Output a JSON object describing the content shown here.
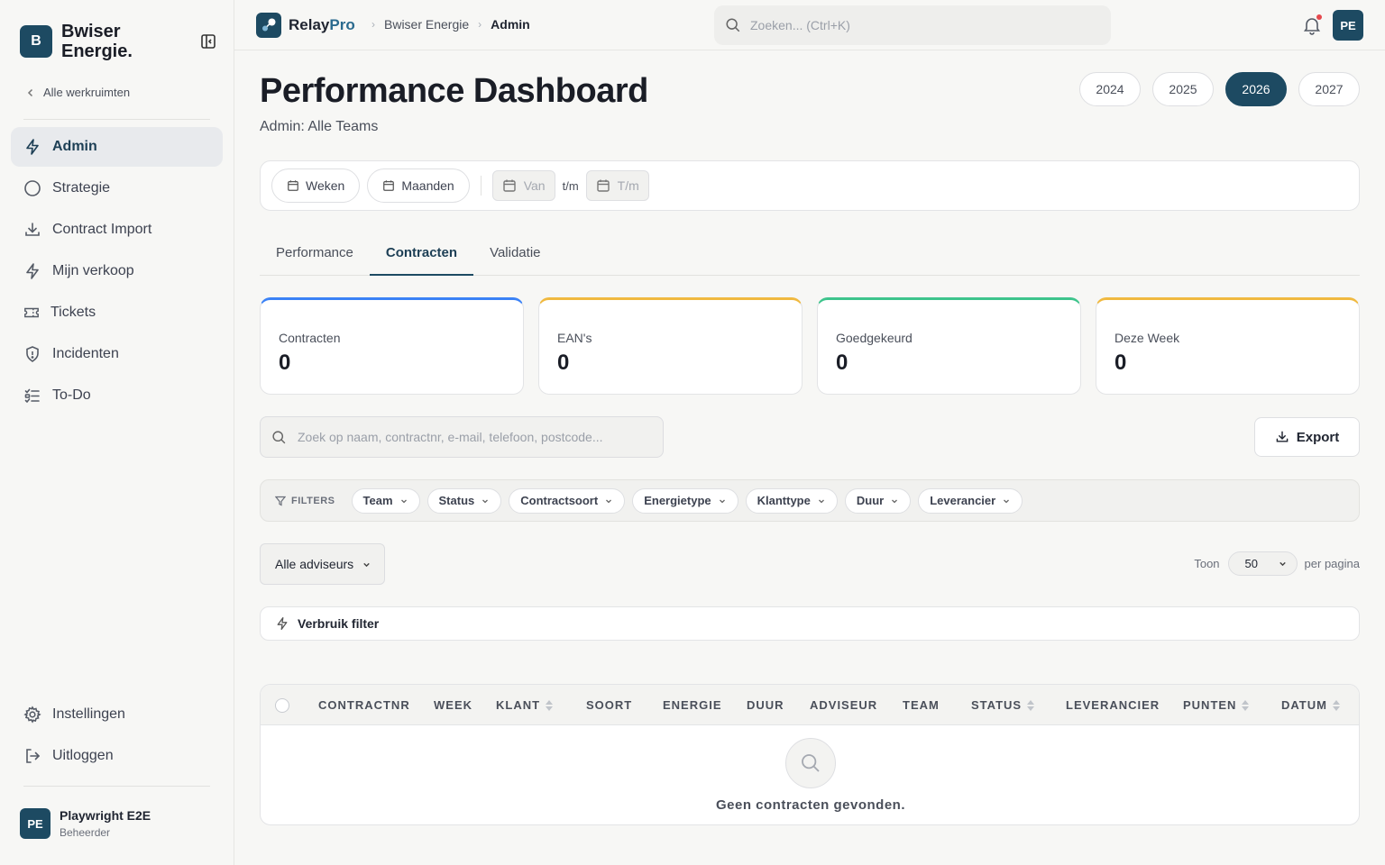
{
  "sidebar": {
    "brand_initial": "B",
    "brand_name": "Bwiser Energie.",
    "back_label": "Alle werkruimten",
    "items": [
      {
        "label": "Admin",
        "icon": "bolt-icon",
        "active": true
      },
      {
        "label": "Strategie",
        "icon": "circle-icon"
      },
      {
        "label": "Contract Import",
        "icon": "download-icon"
      },
      {
        "label": "Mijn verkoop",
        "icon": "bolt-icon"
      },
      {
        "label": "Tickets",
        "icon": "ticket-icon"
      },
      {
        "label": "Incidenten",
        "icon": "shield-alert-icon"
      },
      {
        "label": "To-Do",
        "icon": "checklist-icon"
      }
    ],
    "bottom_items": [
      {
        "label": "Instellingen",
        "icon": "gear-icon"
      },
      {
        "label": "Uitloggen",
        "icon": "logout-icon"
      }
    ],
    "user": {
      "initials": "PE",
      "name": "Playwright E2E",
      "role": "Beheerder"
    }
  },
  "topbar": {
    "logo_main": "Relay",
    "logo_accent": "Pro",
    "breadcrumb": [
      "Bwiser Energie",
      "Admin"
    ],
    "search_placeholder": "Zoeken... (Ctrl+K)",
    "avatar_initials": "PE"
  },
  "page": {
    "title": "Performance Dashboard",
    "subtitle": "Admin: Alle Teams",
    "years": [
      "2024",
      "2025",
      "2026",
      "2027"
    ],
    "active_year": "2026"
  },
  "range": {
    "weeks_label": "Weken",
    "months_label": "Maanden",
    "from_placeholder": "Van",
    "to_separator": "t/m",
    "to_placeholder": "T/m"
  },
  "tabs": [
    {
      "label": "Performance"
    },
    {
      "label": "Contracten",
      "active": true
    },
    {
      "label": "Validatie"
    }
  ],
  "stats": [
    {
      "label": "Contracten",
      "value": "0",
      "color": "#3b82f6"
    },
    {
      "label": "EAN's",
      "value": "0",
      "color": "#f0b940"
    },
    {
      "label": "Goedgekeurd",
      "value": "0",
      "color": "#3ec48c"
    },
    {
      "label": "Deze Week",
      "value": "0",
      "color": "#f0b940"
    }
  ],
  "search_placeholder": "Zoek op naam, contractnr, e-mail, telefoon, postcode...",
  "export_label": "Export",
  "filters": {
    "label": "FILTERS",
    "chips": [
      "Team",
      "Status",
      "Contractsoort",
      "Energietype",
      "Klanttype",
      "Duur",
      "Leverancier"
    ]
  },
  "adviseurs_label": "Alle adviseurs",
  "pagination": {
    "show_label": "Toon",
    "per_page_value": "50",
    "per_page_label": "per pagina"
  },
  "usage_filter_label": "Verbruik filter",
  "table": {
    "columns": [
      {
        "label": "CONTRACTNR"
      },
      {
        "label": "WEEK"
      },
      {
        "label": "KLANT",
        "sortable": true
      },
      {
        "label": "SOORT"
      },
      {
        "label": "ENERGIE"
      },
      {
        "label": "DUUR"
      },
      {
        "label": "ADVISEUR"
      },
      {
        "label": "TEAM"
      },
      {
        "label": "STATUS",
        "sortable": true
      },
      {
        "label": "LEVERANCIER"
      },
      {
        "label": "PUNTEN",
        "sortable": true
      },
      {
        "label": "DATUM",
        "sortable": true
      }
    ],
    "empty_text": "Geen contracten gevonden."
  }
}
